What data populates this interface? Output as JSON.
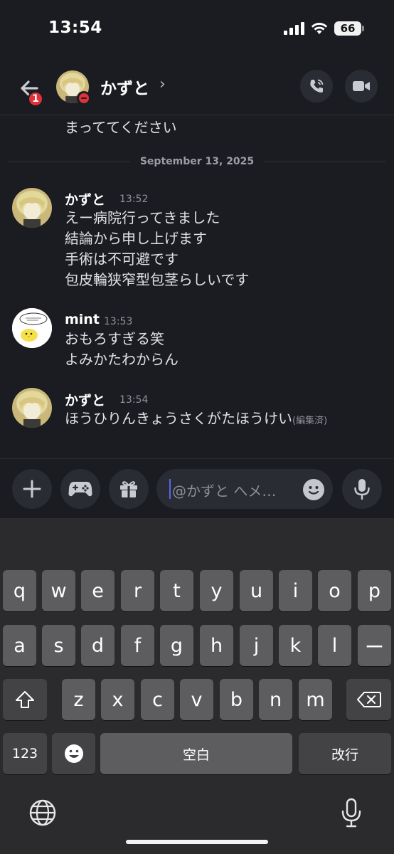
{
  "status": {
    "time": "13:54",
    "battery": "66"
  },
  "header": {
    "notification_count": "1",
    "name": "かずと",
    "chevron": "›"
  },
  "messages": {
    "previous_tail": "まっててください",
    "date_divider": "September 13, 2025",
    "groups": [
      {
        "author": "かずと",
        "time": "13:52",
        "lines": [
          "えー病院行ってきました",
          "結論から申し上げます",
          "手術は不可避です",
          "包皮輪狭窄型包茎らしいです"
        ]
      },
      {
        "author": "mint",
        "time": "13:53",
        "lines": [
          "おもろすぎる笑",
          "よみかたわからん"
        ]
      },
      {
        "author": "かずと",
        "time": "13:54",
        "lines": [
          "ほうひりんきょうさくがたほうけい"
        ],
        "edited": "(編集済)"
      }
    ]
  },
  "composer": {
    "placeholder": "@かずと へメ…"
  },
  "keyboard": {
    "row1": [
      "q",
      "w",
      "e",
      "r",
      "t",
      "y",
      "u",
      "i",
      "o",
      "p"
    ],
    "row2": [
      "a",
      "s",
      "d",
      "f",
      "g",
      "h",
      "j",
      "k",
      "l",
      "ー"
    ],
    "row3": [
      "z",
      "x",
      "c",
      "v",
      "b",
      "n",
      "m"
    ],
    "numbers_key": "123",
    "space_key": "空白",
    "return_key": "改行"
  },
  "colors": {
    "background": "#1b1c21",
    "danger": "#e0323a",
    "accent": "#5865f2"
  }
}
